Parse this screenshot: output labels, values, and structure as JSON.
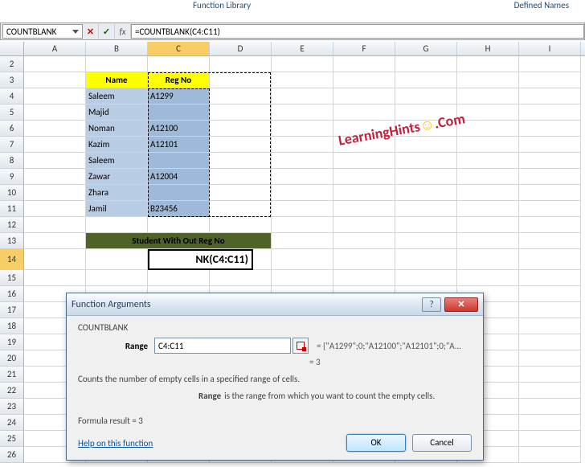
{
  "ribbon": {
    "functionLibrary": "Function Library",
    "definedNames": "Defined Names"
  },
  "nameBox": "COUNTBLANK",
  "formula": "=COUNTBLANK(C4:C11)",
  "columns": [
    "A",
    "B",
    "C",
    "D",
    "E",
    "F",
    "G",
    "H",
    "I"
  ],
  "rows": [
    "2",
    "3",
    "4",
    "5",
    "6",
    "7",
    "8",
    "9",
    "10",
    "11",
    "12",
    "13",
    "14",
    "15",
    "16",
    "17",
    "18",
    "19",
    "20",
    "21",
    "22",
    "23",
    "24",
    "25",
    "26"
  ],
  "headers": {
    "B3": "Name",
    "C3": "Reg No"
  },
  "data": {
    "B4": "Saleem",
    "C4": "A1299",
    "B5": "Majid",
    "C5": "",
    "B6": "Noman",
    "C6": "A12100",
    "B7": "Kazim",
    "C7": "A12101",
    "B8": "Saleem",
    "C8": "",
    "B9": "Zawar",
    "C9": "A12004",
    "B10": "Zhara",
    "C10": "",
    "B11": "Jamil",
    "C11": "B23456"
  },
  "mergedTitle": "Student With Out Reg No",
  "activeCell": "NK(C4:C11)",
  "watermark": {
    "p1": "LearningHints",
    "p2": ".Com"
  },
  "dialog": {
    "title": "Function Arguments",
    "funcName": "COUNTBLANK",
    "argLabel": "Range",
    "argValue": "C4:C11",
    "argEval": "= {\"A1299\";0;\"A12100\";\"A12101\";0;\"A...",
    "resultEval": "= 3",
    "description": "Counts the number of empty cells in a specified range of cells.",
    "paramName": "Range",
    "paramDesc": "is the range from which you want to count the empty cells.",
    "formulaResult": "Formula result = 3",
    "helpLink": "Help on this function",
    "ok": "OK",
    "cancel": "Cancel",
    "help": "?",
    "close": "✕"
  }
}
